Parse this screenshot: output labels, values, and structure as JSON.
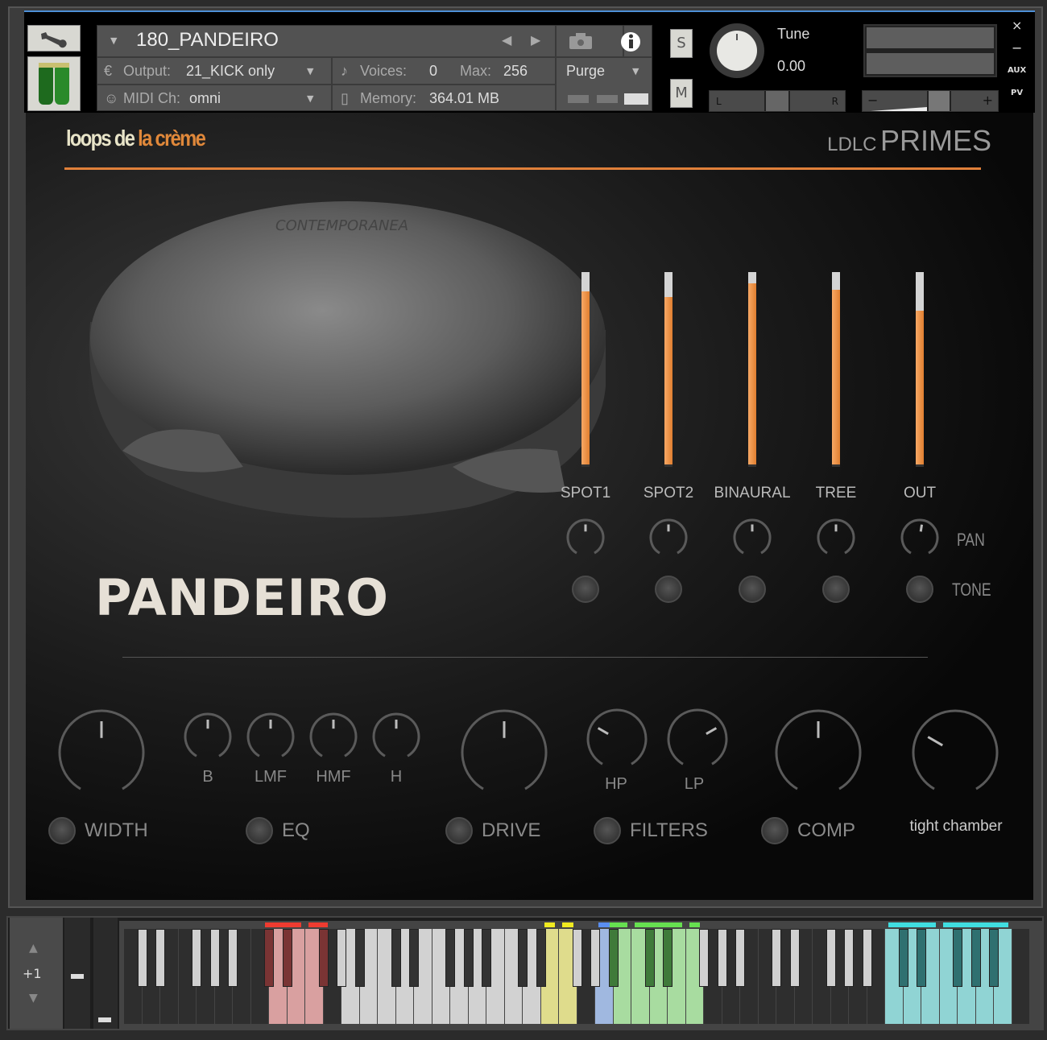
{
  "header": {
    "instrument_name": "180_PANDEIRO",
    "output_label": "Output:",
    "output_value": "21_KICK only",
    "voices_label": "Voices:",
    "voices_value": "0",
    "max_label": "Max:",
    "max_value": "256",
    "midi_label": "MIDI Ch:",
    "midi_value": "omni",
    "memory_label": "Memory:",
    "memory_value": "364.01 MB",
    "purge_label": "Purge",
    "solo_label": "S",
    "mute_label": "M",
    "tune_label": "Tune",
    "tune_value": "0.00",
    "pan_left": "L",
    "pan_right": "R",
    "vol_minus": "−",
    "vol_plus": "+",
    "close": "×",
    "minimize": "−",
    "aux": "AUX",
    "pv": "PV",
    "icons": [
      "wrench-icon",
      "instrument-icon",
      "prev-arrow-icon",
      "next-arrow-icon",
      "camera-icon",
      "info-icon"
    ]
  },
  "brand": {
    "logo_part1": "loops de",
    "logo_part2": "la crème",
    "product_prefix": "LDLC",
    "product_name": "PRIMES",
    "accent": "#e0803a",
    "drum_brand": "CONTEMPORANEA"
  },
  "title": "PANDEIRO",
  "mixer": {
    "channels": [
      {
        "label": "SPOT1",
        "level": 0.9,
        "pan": 0.5
      },
      {
        "label": "SPOT2",
        "level": 0.87,
        "pan": 0.5
      },
      {
        "label": "BINAURAL",
        "level": 0.94,
        "pan": 0.5
      },
      {
        "label": "TREE",
        "level": 0.91,
        "pan": 0.5
      },
      {
        "label": "OUT",
        "level": 0.8,
        "pan": 0.53
      }
    ],
    "pan_label": "PAN",
    "tone_label": "TONE"
  },
  "effects": {
    "width": {
      "label": "WIDTH",
      "value": 0.5
    },
    "eq": {
      "label": "EQ",
      "bands": [
        {
          "label": "B",
          "value": 0.5
        },
        {
          "label": "LMF",
          "value": 0.5
        },
        {
          "label": "HMF",
          "value": 0.5
        },
        {
          "label": "H",
          "value": 0.5
        }
      ]
    },
    "drive": {
      "label": "DRIVE",
      "value": 0.5
    },
    "filters": {
      "label": "FILTERS",
      "hp": {
        "label": "HP",
        "value": 0.3
      },
      "lp": {
        "label": "LP",
        "value": 0.7
      }
    },
    "comp": {
      "label": "COMP",
      "value": 0.5
    },
    "reverb": {
      "label": "tight chamber",
      "value": 0.3
    }
  },
  "keyboard": {
    "octave_shift": "+1",
    "zones": [
      {
        "from": 13,
        "to": 18,
        "color": "#d9a0a0",
        "dark": "#7a3434",
        "indicator": "#ee3b30"
      },
      {
        "from": 21,
        "to": 39,
        "color": "#d2d2d2",
        "dark": "#333333",
        "indicator": null
      },
      {
        "from": 40,
        "to": 41,
        "color": "#dfdc8c",
        "dark": "#333333",
        "indicator": "#f0ea20"
      },
      {
        "from": 45,
        "to": 45,
        "color": "#a0b8e0",
        "dark": "#333333",
        "indicator": "#5a8ef0"
      },
      {
        "from": 46,
        "to": 53,
        "color": "#a8dca0",
        "dark": "#3f7a3a",
        "indicator": "#66e050"
      },
      {
        "from": 72,
        "to": 83,
        "color": "#90d4d4",
        "dark": "#2f7070",
        "indicator": "#40dde0"
      }
    ]
  }
}
